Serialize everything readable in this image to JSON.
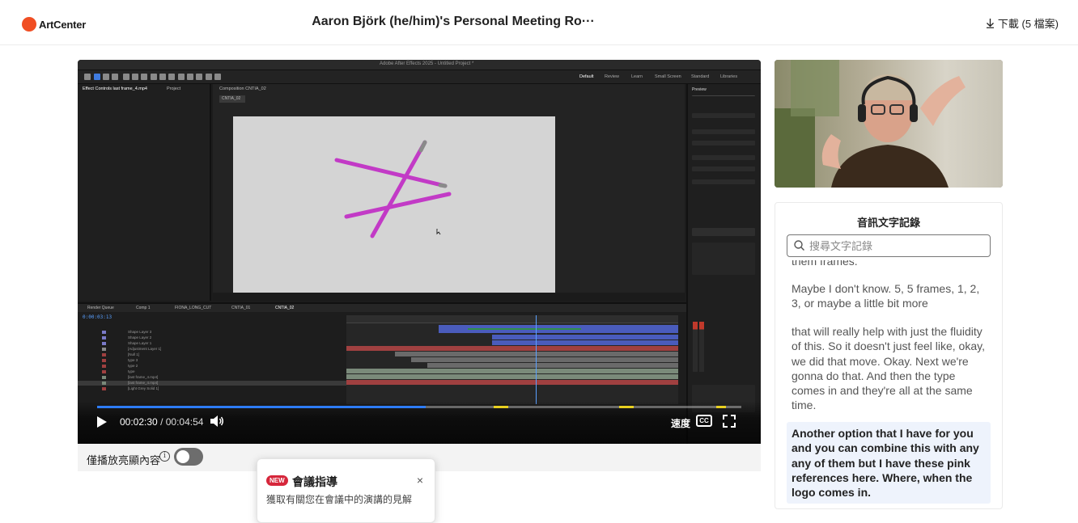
{
  "header": {
    "logo_text": "ArtCenter",
    "title": "Aaron Björk (he/him)'s Personal Meeting Ro···",
    "download_label": "下載 (5 檔案)"
  },
  "app": {
    "window_title": "Adobe After Effects 2025 - Untitled Project *",
    "workspaces": [
      "Default",
      "Review",
      "Learn",
      "Small Screen",
      "Standard",
      "Libraries"
    ],
    "left_panel_tabs": [
      "Effect Controls last frame_4.mp4",
      "Project"
    ],
    "comp_tab": "Composition CNTIA_02",
    "comp_subtab": "CNTIA_02",
    "timeline_tabs": [
      "Render Queue",
      "Comp 1",
      "FIONA_LONG_CUT",
      "CNTIA_01",
      "CNTIA_02"
    ],
    "timecode": "0:00:03:13",
    "layers": [
      "Shape Layer 3",
      "Shape Layer 2",
      "Shape Layer 1",
      "[Adjustment Layer 1]",
      "[Null 1]",
      "type 3",
      "type 2",
      "type",
      "[last frame_4.mp4]",
      "[last frame_4.mp4]",
      "[Light Grey Solid 1]"
    ]
  },
  "player": {
    "current_time": "00:02:30",
    "separator": "/",
    "total_time": "00:04:54",
    "progress": 0.51,
    "speed_label": "速度",
    "cc_label": "CC"
  },
  "highlights": {
    "label": "僅播放亮顯內容",
    "toggle_on": false
  },
  "popover": {
    "badge": "NEW",
    "title": "會議指導",
    "close": "×",
    "body": "獲取有關您在會議中的演講的見解"
  },
  "transcript": {
    "heading": "音訊文字記錄",
    "search_placeholder": "搜尋文字記錄",
    "segments": [
      {
        "text": "them frames.",
        "active": false
      },
      {
        "text": "Maybe I don't know. 5, 5 frames, 1, 2, 3, or maybe a little bit more",
        "active": false
      },
      {
        "text": "that will really help with just the fluidity of this. So it doesn't just feel like, okay, we did that move. Okay. Next we're gonna do that. And then the type comes in and they're all at the same time.",
        "active": false
      },
      {
        "text": "Another option that I have for you and you can combine this with any any of them but I have these pink references here. Where, when the logo comes in.",
        "active": true
      }
    ]
  },
  "colors": {
    "brand": "#f04e23",
    "progress": "#2d7cf6",
    "stroke": "#c23ac6",
    "active_segment_bg": "#eef3fc",
    "badge": "#d6263b"
  }
}
